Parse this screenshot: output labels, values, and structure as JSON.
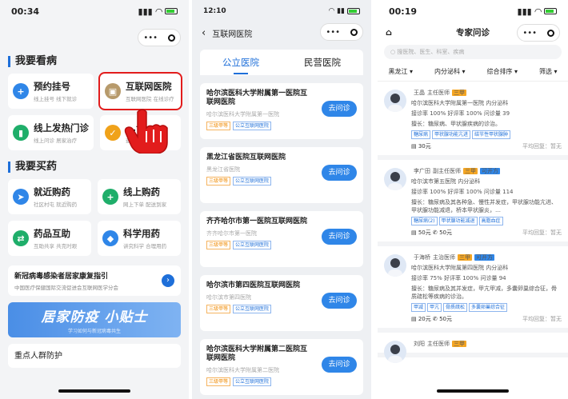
{
  "panel1": {
    "time": "00:34",
    "section_see": "我要看病",
    "cards_see": [
      {
        "title": "预约挂号",
        "sub": "线上挂号 线下就诊",
        "color": "#2f86e8",
        "glyph": "+"
      },
      {
        "title": "互联网医院",
        "sub": "互联网医院 在线诊疗",
        "color": "#b79a6b",
        "glyph": "▣"
      },
      {
        "title": "线上发热门诊",
        "sub": "线上问诊 居家治疗",
        "color": "#1fae6a",
        "glyph": "▮"
      },
      {
        "title": "...诊",
        "sub": "查询...",
        "color": "#f0a21a",
        "glyph": "✓"
      }
    ],
    "section_buy": "我要买药",
    "cards_buy": [
      {
        "title": "就近购药",
        "sub": "社区村屯 就近购药",
        "color": "#2f86e8",
        "glyph": "➤"
      },
      {
        "title": "线上购药",
        "sub": "网上下单 配送到家",
        "color": "#1fae6a",
        "glyph": "+"
      },
      {
        "title": "药品互助",
        "sub": "互助共享 共克时艰",
        "color": "#1fae6a",
        "glyph": "⇄"
      },
      {
        "title": "科学用药",
        "sub": "讲究科学 合理用药",
        "color": "#2f86e8",
        "glyph": "◆"
      }
    ],
    "banner_title": "新冠病毒感染者居家康复指引",
    "banner_sub": "中国医疗保健国际交流促进会互联网医学分会",
    "tips_title": "居家防疫 小贴士",
    "tips_sub": "学习如何与新冠病毒共生",
    "last_item": "重点人群防护"
  },
  "panel2": {
    "time": "12:10",
    "nav_title": "互联网医院",
    "tab_public": "公立医院",
    "tab_private": "民营医院",
    "go_label": "去问诊",
    "hospitals": [
      {
        "name": "哈尔滨医科大学附属第一医院互联网医院",
        "sub": "哈尔滨医科大学附属第一医院",
        "tags": [
          "三级甲等",
          "公立互联网医院"
        ]
      },
      {
        "name": "黑龙江省医院互联网医院",
        "sub": "黑龙江省医院",
        "tags": [
          "三级甲等",
          "公立互联网医院"
        ]
      },
      {
        "name": "齐齐哈尔市第一医院互联网医院",
        "sub": "齐齐哈尔市第一医院",
        "tags": [
          "三级甲等",
          "公立互联网医院"
        ]
      },
      {
        "name": "哈尔滨市第四医院互联网医院",
        "sub": "哈尔滨市第四医院",
        "tags": [
          "三级甲等",
          "公立互联网医院"
        ]
      },
      {
        "name": "哈尔滨医科大学附属第二医院互联网医院",
        "sub": "哈尔滨医科大学附属第二医院",
        "tags": [
          "三级甲等",
          "公立互联网医院"
        ]
      }
    ]
  },
  "panel3": {
    "time": "00:19",
    "nav_title": "专家问诊",
    "search_placeholder": "搜医院、医生、科室、疾病",
    "filters": [
      "黑龙江",
      "内分泌科",
      "综合排序",
      "筛选"
    ],
    "doctors": [
      {
        "name": "王晶",
        "title": "主任医师",
        "badges": [
          "三甲"
        ],
        "hosp": "哈尔滨医科大学附属第一医院 内分泌科",
        "rate": "接诊率 100% 好评率 100% 问诊量 39",
        "skill": "擅长：糖尿病、甲状腺疾病的诊治。",
        "tags": [
          "糖尿病",
          "甲状腺功能亢进",
          "结节性甲状腺肿"
        ],
        "price1": "30元",
        "price2": "",
        "reply": "平均回复：暂无"
      },
      {
        "name": "李广田",
        "title": "副主任医师",
        "badges": [
          "三甲",
          "可开方"
        ],
        "hosp": "哈尔滨市第五医院 内分泌科",
        "rate": "接诊率 100% 好评率 100% 问诊量 114",
        "skill": "擅长：糖尿病及其各种急、慢性并发症，甲状腺功能亢进、甲状腺功能减退，桥本甲状腺炎，…",
        "tags": [
          "糖尿病(2)",
          "甲状腺功能减退",
          "高脂血症"
        ],
        "price1": "50元",
        "price2": "50元",
        "reply": "平均回复：暂无"
      },
      {
        "name": "于海桥",
        "title": "主治医师",
        "badges": [
          "三甲",
          "可开方"
        ],
        "hosp": "哈尔滨医科大学附属第四医院 内分泌科",
        "rate": "接诊率 75% 好评率 100% 问诊量 94",
        "skill": "擅长：糖尿病及其并发症，甲亢甲减，多囊卵巢综合征，骨质疏松等疾病的诊治。",
        "tags": [
          "甲减",
          "甲亢",
          "骨质疏松",
          "多囊卵巢综合征"
        ],
        "price1": "20元",
        "price2": "50元",
        "reply": "平均回复：暂无"
      },
      {
        "name": "刘阳",
        "title": "主任医师",
        "badges": [
          "三甲"
        ],
        "hosp": "",
        "rate": "",
        "skill": "",
        "tags": [],
        "price1": "",
        "price2": "",
        "reply": ""
      }
    ]
  }
}
